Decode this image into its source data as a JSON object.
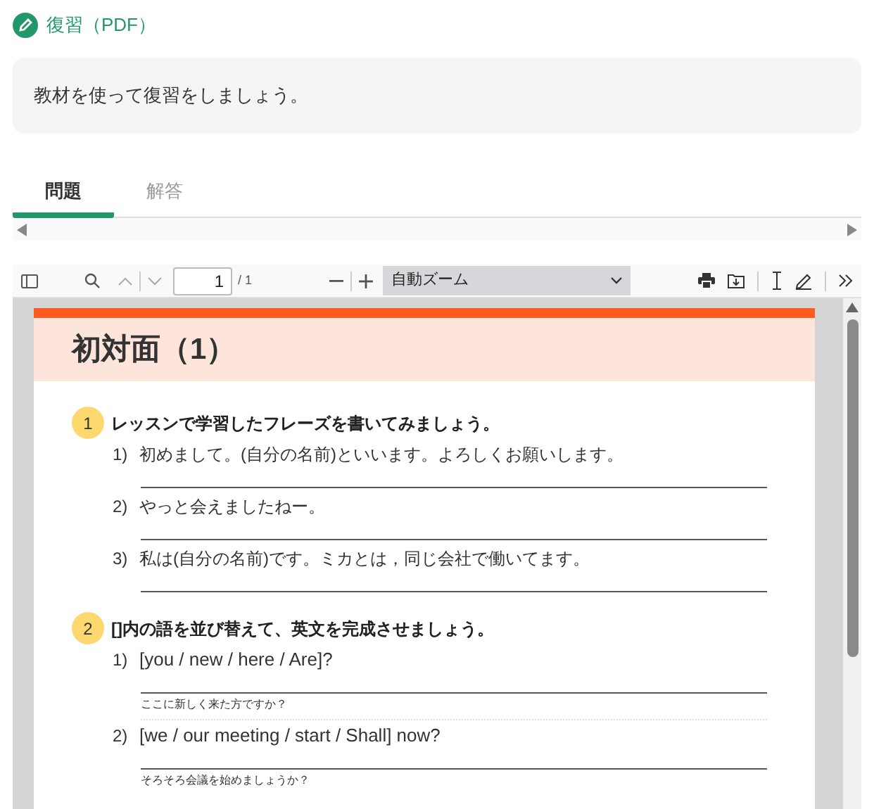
{
  "header": {
    "title": "復習（PDF）"
  },
  "instruction": "教材を使って復習をしましょう。",
  "tabs": [
    {
      "label": "問題",
      "selected": true
    },
    {
      "label": "解答",
      "selected": false
    }
  ],
  "toolbar": {
    "page_number": "1",
    "page_count": "/ 1",
    "zoom": "自動ズーム"
  },
  "pdf": {
    "title": "初対面（1）",
    "sections": [
      {
        "number": "1",
        "heading": "レッスンで学習したフレーズを書いてみましょう。",
        "items": [
          {
            "number": "1)",
            "text": "初めまして。(自分の名前)といいます。よろしくお願いします。"
          },
          {
            "number": "2)",
            "text": "やっと会えましたねー。"
          },
          {
            "number": "3)",
            "text": "私は(自分の名前)です。ミカとは，同じ会社で働いてます。"
          }
        ]
      },
      {
        "number": "2",
        "heading": "[]内の語を並び替えて、英文を完成させましょう。",
        "items": [
          {
            "number": "1)",
            "text": "[you / new / here / Are]?",
            "hint": "ここに新しく来た方ですか？"
          },
          {
            "number": "2)",
            "text": "[we / our meeting / start / Shall] now?",
            "hint": "そろそろ会議を始めましょうか？"
          }
        ]
      }
    ]
  }
}
